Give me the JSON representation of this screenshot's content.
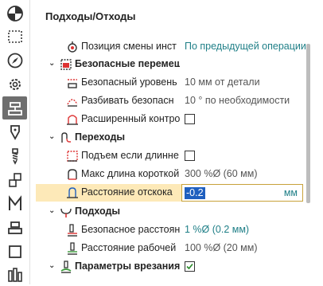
{
  "panel": {
    "title": "Подходы/Отходы"
  },
  "rows": {
    "r1": {
      "label": "Позиция смены инст",
      "value": "По предыдущей операции"
    },
    "g1": {
      "label": "Безопасные перемещ"
    },
    "r2": {
      "label": "Безопасный уровень",
      "value": "10 мм от детали"
    },
    "r3": {
      "label": "Разбивать безопасн",
      "value": "10 ° по необходимости"
    },
    "r4": {
      "label": "Расширенный контро"
    },
    "g2": {
      "label": "Переходы"
    },
    "r5": {
      "label": "Подъем если длинне"
    },
    "r6": {
      "label": "Макс длина короткой",
      "value": "300 %Ø (60 мм)"
    },
    "r7": {
      "label": "Расстояние отскока",
      "value": "-0.2",
      "unit": "мм"
    },
    "g3": {
      "label": "Подходы"
    },
    "r8": {
      "label": "Безопасное расстоян",
      "value": "1 %Ø (0.2 мм)"
    },
    "r9": {
      "label": "Расстояние рабочей",
      "value": "100 %Ø (20 мм)"
    },
    "g4": {
      "label": "Параметры врезания"
    }
  },
  "colors": {
    "accent": "#1f7f87",
    "highlight": "#fde9b8",
    "active_tool": "#6e6e6e"
  }
}
